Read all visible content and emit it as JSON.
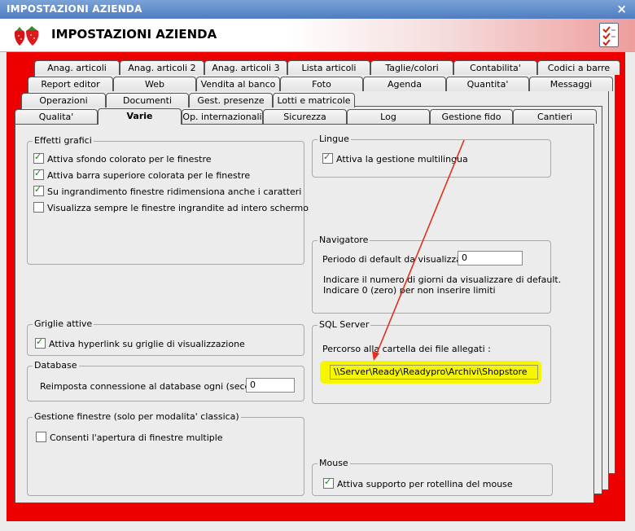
{
  "window": {
    "title": "IMPOSTAZIONI AZIENDA",
    "close": "×"
  },
  "header": {
    "title": "IMPOSTAZIONI AZIENDA"
  },
  "tabs": {
    "row1": [
      "Anag. articoli",
      "Anag. articoli 2",
      "Anag. articoli 3",
      "Lista articoli",
      "Taglie/colori",
      "Contabilita'",
      "Codici a barre"
    ],
    "row2": [
      "Report editor",
      "Web",
      "Vendita al banco",
      "Foto",
      "Agenda",
      "Quantita'",
      "Messaggi"
    ],
    "row3": [
      "Operazioni",
      "Documenti",
      "Gest. presenze",
      "Lotti e matricole"
    ],
    "row4": [
      "Qualita'",
      "Varie",
      "Op. internazionali",
      "Sicurezza",
      "Log",
      "Gestione fido",
      "Cantieri"
    ]
  },
  "effetti": {
    "title": "Effetti grafici",
    "items": [
      {
        "label": "Attiva sfondo colorato per le finestre",
        "checked": true
      },
      {
        "label": "Attiva barra superiore colorata per le finestre",
        "checked": true
      },
      {
        "label": "Su ingrandimento finestre ridimensiona anche i caratteri",
        "checked": true
      },
      {
        "label": "Visualizza sempre le finestre ingrandite ad intero schermo",
        "checked": false
      }
    ]
  },
  "griglie": {
    "title": "Griglie attive",
    "item": "Attiva hyperlink su griglie di visualizzazione",
    "checked": true
  },
  "database": {
    "title": "Database",
    "label": "Reimposta connessione al database ogni (secondi) :",
    "value": "0"
  },
  "gestione": {
    "title": "Gestione finestre (solo per modalita' classica)",
    "item": "Consenti l'apertura di finestre multiple",
    "checked": false
  },
  "lingue": {
    "title": "Lingue",
    "item": "Attiva la gestione multilingua",
    "checked": true
  },
  "navigatore": {
    "title": "Navigatore",
    "label": "Periodo di default da visualizzare :",
    "value": "0",
    "hint1": "Indicare il numero di giorni da visualizzare di default.",
    "hint2": "Indicare 0 (zero) per non inserire limiti"
  },
  "sql": {
    "title": "SQL Server",
    "label": "Percorso alla cartella dei file allegati :",
    "value": "\\\\Server\\Ready\\Readypro\\Archivi\\Shopstore"
  },
  "mouse": {
    "title": "Mouse",
    "item": "Attiva supporto per rotellina del mouse",
    "checked": true
  },
  "colors": {
    "accent_red": "#ee0000",
    "highlight": "#f6f600",
    "arrow": "#e0301e"
  }
}
